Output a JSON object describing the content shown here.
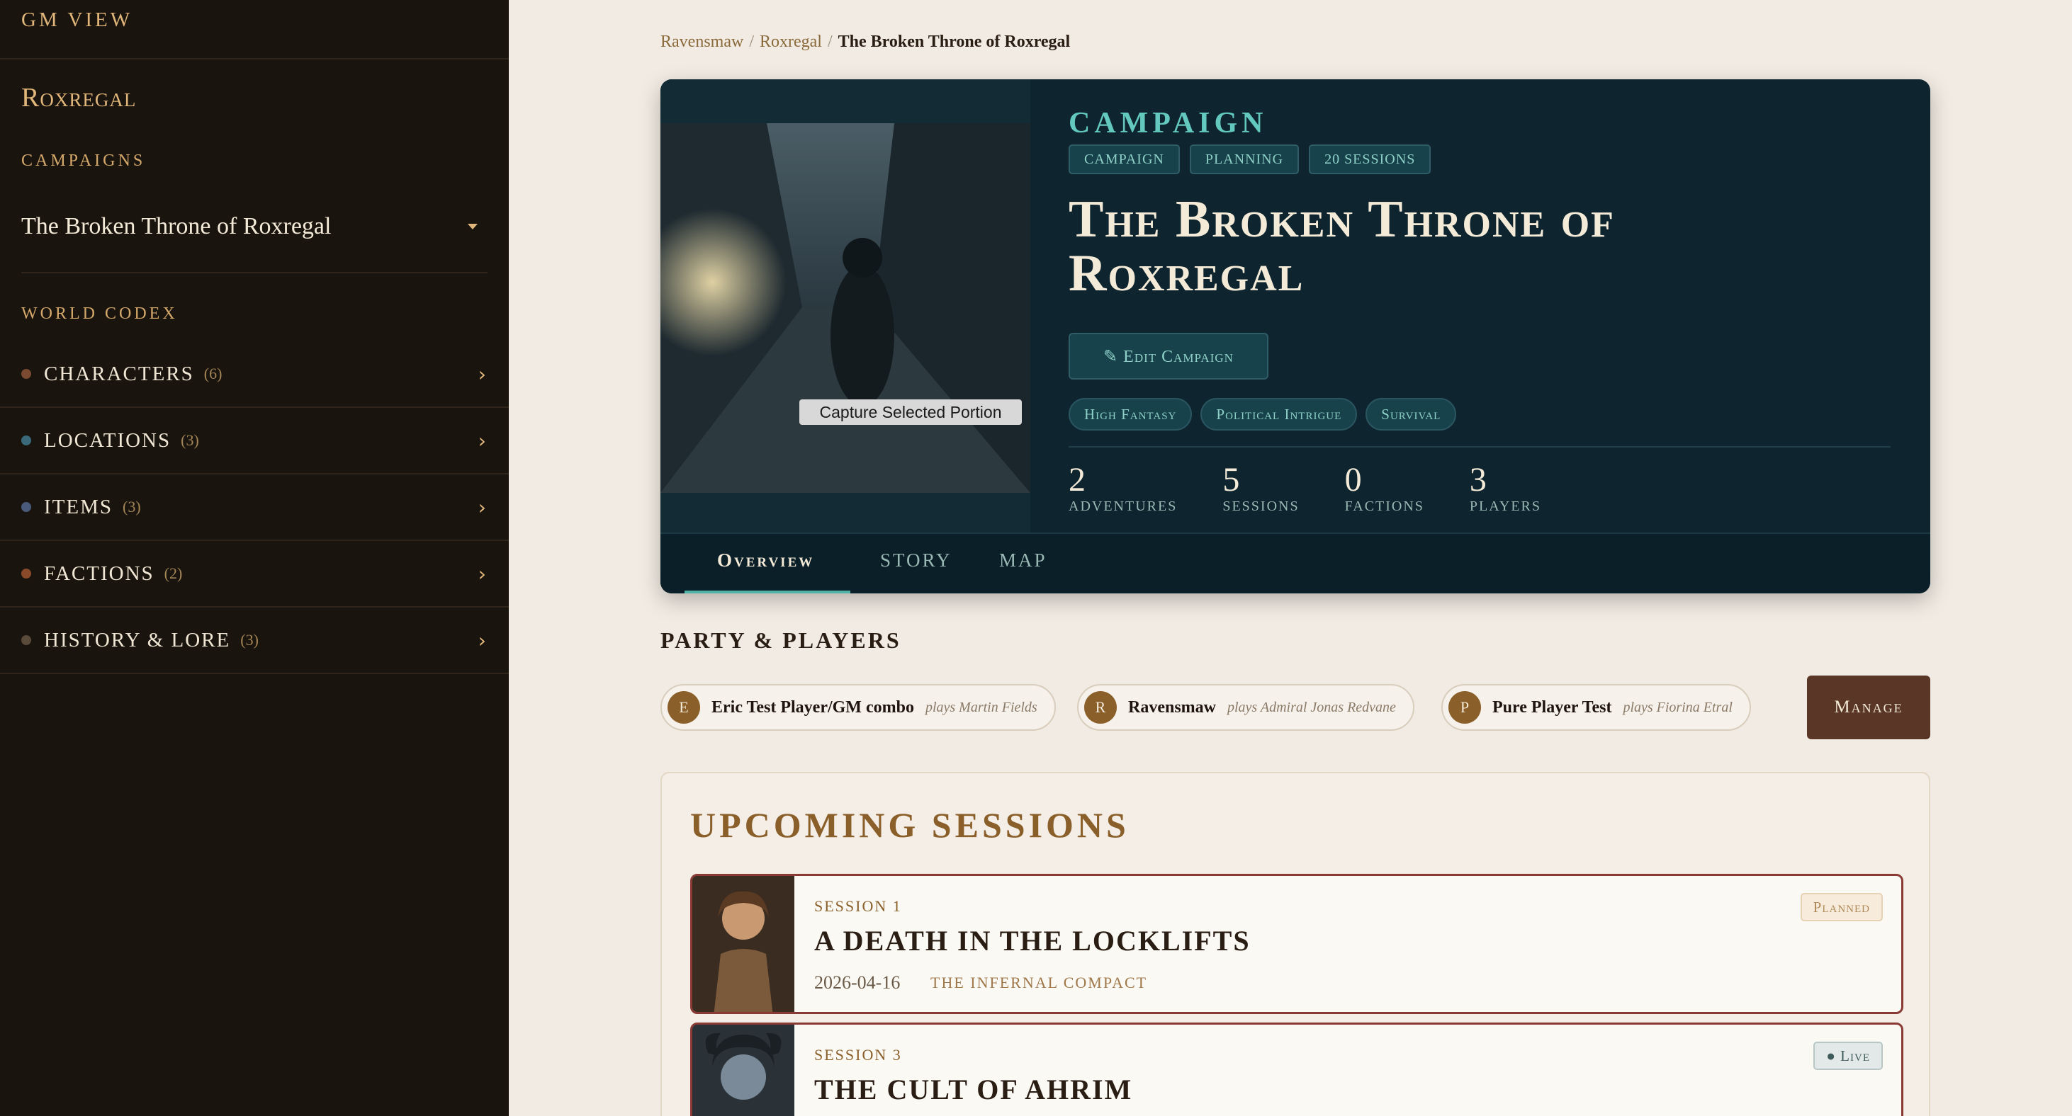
{
  "sidebar": {
    "gm_view": "GM VIEW",
    "world": "Roxregal",
    "campaigns_label": "CAMPAIGNS",
    "selected_campaign": "The Broken Throne of Roxregal",
    "codex_label": "WORLD CODEX",
    "codex_items": [
      {
        "label": "CHARACTERS",
        "count": "(6)",
        "color": "#8a5a3a"
      },
      {
        "label": "LOCATIONS",
        "count": "(3)",
        "color": "#3a6a7a"
      },
      {
        "label": "ITEMS",
        "count": "(3)",
        "color": "#4a5a7a"
      },
      {
        "label": "FACTIONS",
        "count": "(2)",
        "color": "#8a4a2a"
      },
      {
        "label": "HISTORY & LORE",
        "count": "(3)",
        "color": "#5a4a3a"
      }
    ]
  },
  "breadcrumb": {
    "items": [
      "Ravensmaw",
      "Roxregal"
    ],
    "current": "The Broken Throne of Roxregal"
  },
  "hero": {
    "kicker": "CAMPAIGN",
    "chips": [
      "CAMPAIGN",
      "PLANNING",
      "20 SESSIONS"
    ],
    "title": "The Broken Throne of Roxregal",
    "edit_label": "✎ Edit Campaign",
    "tags": [
      "High Fantasy",
      "Political Intrigue",
      "Survival"
    ],
    "stats": [
      {
        "value": "2",
        "label": "ADVENTURES"
      },
      {
        "value": "5",
        "label": "SESSIONS"
      },
      {
        "value": "0",
        "label": "FACTIONS"
      },
      {
        "value": "3",
        "label": "PLAYERS"
      }
    ],
    "capture_tooltip": "Capture Selected Portion",
    "tabs": [
      "Overview",
      "STORY",
      "MAP"
    ],
    "active_tab": "Overview"
  },
  "party": {
    "title": "PARTY & PLAYERS",
    "players": [
      {
        "initial": "E",
        "name": "Eric Test Player/GM combo",
        "role": "plays Martin Fields"
      },
      {
        "initial": "R",
        "name": "Ravensmaw",
        "role": "plays Admiral Jonas Redvane"
      },
      {
        "initial": "P",
        "name": "Pure Player Test",
        "role": "plays Fiorina Etral"
      }
    ],
    "manage_label": "Manage"
  },
  "upcoming": {
    "title": "UPCOMING SESSIONS",
    "sessions": [
      {
        "number": "SESSION 1",
        "title": "A DEATH IN THE LOCKLIFTS",
        "date": "2026-04-16",
        "faction": "THE INFERNAL COMPACT",
        "status": "Planned"
      },
      {
        "number": "SESSION 3",
        "title": "THE CULT OF AHRIM",
        "status": "● Live"
      }
    ]
  }
}
